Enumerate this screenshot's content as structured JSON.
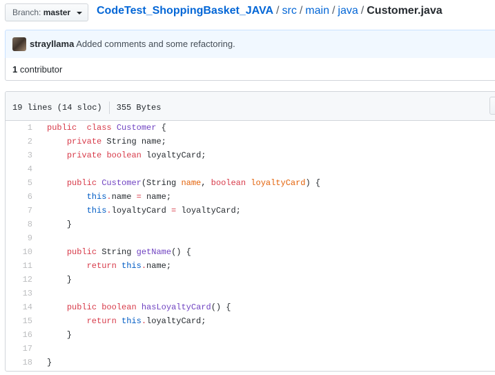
{
  "branch": {
    "prefix": "Branch:",
    "name": "master"
  },
  "breadcrumb": {
    "repo": "CodeTest_ShoppingBasket_JAVA",
    "parts": [
      "src",
      "main",
      "java"
    ],
    "file": "Customer.java",
    "separator": "/"
  },
  "commit": {
    "author": "strayllama",
    "message": "Added comments and some refactoring."
  },
  "contributors": {
    "count": "1",
    "label": "contributor"
  },
  "file": {
    "lines": "19 lines (14 sloc)",
    "size": "355 Bytes"
  },
  "code_lines": [
    {
      "n": "1",
      "tokens": [
        [
          "kw",
          "public"
        ],
        [
          "",
          "  "
        ],
        [
          "kw",
          "class"
        ],
        [
          "",
          " "
        ],
        [
          "ent",
          "Customer"
        ],
        [
          "",
          " {"
        ]
      ]
    },
    {
      "n": "2",
      "tokens": [
        [
          "",
          "    "
        ],
        [
          "kw",
          "private"
        ],
        [
          "",
          " String name;"
        ]
      ]
    },
    {
      "n": "3",
      "tokens": [
        [
          "",
          "    "
        ],
        [
          "kw",
          "private"
        ],
        [
          "",
          " "
        ],
        [
          "kw",
          "boolean"
        ],
        [
          "",
          " loyaltyCard;"
        ]
      ]
    },
    {
      "n": "4",
      "tokens": []
    },
    {
      "n": "5",
      "tokens": [
        [
          "",
          "    "
        ],
        [
          "kw",
          "public"
        ],
        [
          "",
          " "
        ],
        [
          "ent",
          "Customer"
        ],
        [
          "",
          "(String "
        ],
        [
          "var",
          "name"
        ],
        [
          "",
          ", "
        ],
        [
          "kw",
          "boolean"
        ],
        [
          "",
          " "
        ],
        [
          "var",
          "loyaltyCard"
        ],
        [
          "",
          ") {"
        ]
      ]
    },
    {
      "n": "6",
      "tokens": [
        [
          "",
          "        "
        ],
        [
          "cst",
          "this"
        ],
        [
          "kw",
          "."
        ],
        [
          "",
          "name "
        ],
        [
          "kw",
          "="
        ],
        [
          "",
          " name;"
        ]
      ]
    },
    {
      "n": "7",
      "tokens": [
        [
          "",
          "        "
        ],
        [
          "cst",
          "this"
        ],
        [
          "kw",
          "."
        ],
        [
          "",
          "loyaltyCard "
        ],
        [
          "kw",
          "="
        ],
        [
          "",
          " loyaltyCard;"
        ]
      ]
    },
    {
      "n": "8",
      "tokens": [
        [
          "",
          "    }"
        ]
      ]
    },
    {
      "n": "9",
      "tokens": []
    },
    {
      "n": "10",
      "tokens": [
        [
          "",
          "    "
        ],
        [
          "kw",
          "public"
        ],
        [
          "",
          " String "
        ],
        [
          "ent",
          "getName"
        ],
        [
          "",
          "() {"
        ]
      ]
    },
    {
      "n": "11",
      "tokens": [
        [
          "",
          "        "
        ],
        [
          "kw",
          "return"
        ],
        [
          "",
          " "
        ],
        [
          "cst",
          "this"
        ],
        [
          "kw",
          "."
        ],
        [
          "",
          "name;"
        ]
      ]
    },
    {
      "n": "12",
      "tokens": [
        [
          "",
          "    }"
        ]
      ]
    },
    {
      "n": "13",
      "tokens": []
    },
    {
      "n": "14",
      "tokens": [
        [
          "",
          "    "
        ],
        [
          "kw",
          "public"
        ],
        [
          "",
          " "
        ],
        [
          "kw",
          "boolean"
        ],
        [
          "",
          " "
        ],
        [
          "ent",
          "hasLoyaltyCard"
        ],
        [
          "",
          "() {"
        ]
      ]
    },
    {
      "n": "15",
      "tokens": [
        [
          "",
          "        "
        ],
        [
          "kw",
          "return"
        ],
        [
          "",
          " "
        ],
        [
          "cst",
          "this"
        ],
        [
          "kw",
          "."
        ],
        [
          "",
          "loyaltyCard;"
        ]
      ]
    },
    {
      "n": "16",
      "tokens": [
        [
          "",
          "    }"
        ]
      ]
    },
    {
      "n": "17",
      "tokens": []
    },
    {
      "n": "18",
      "tokens": [
        [
          "",
          "}"
        ]
      ]
    }
  ]
}
